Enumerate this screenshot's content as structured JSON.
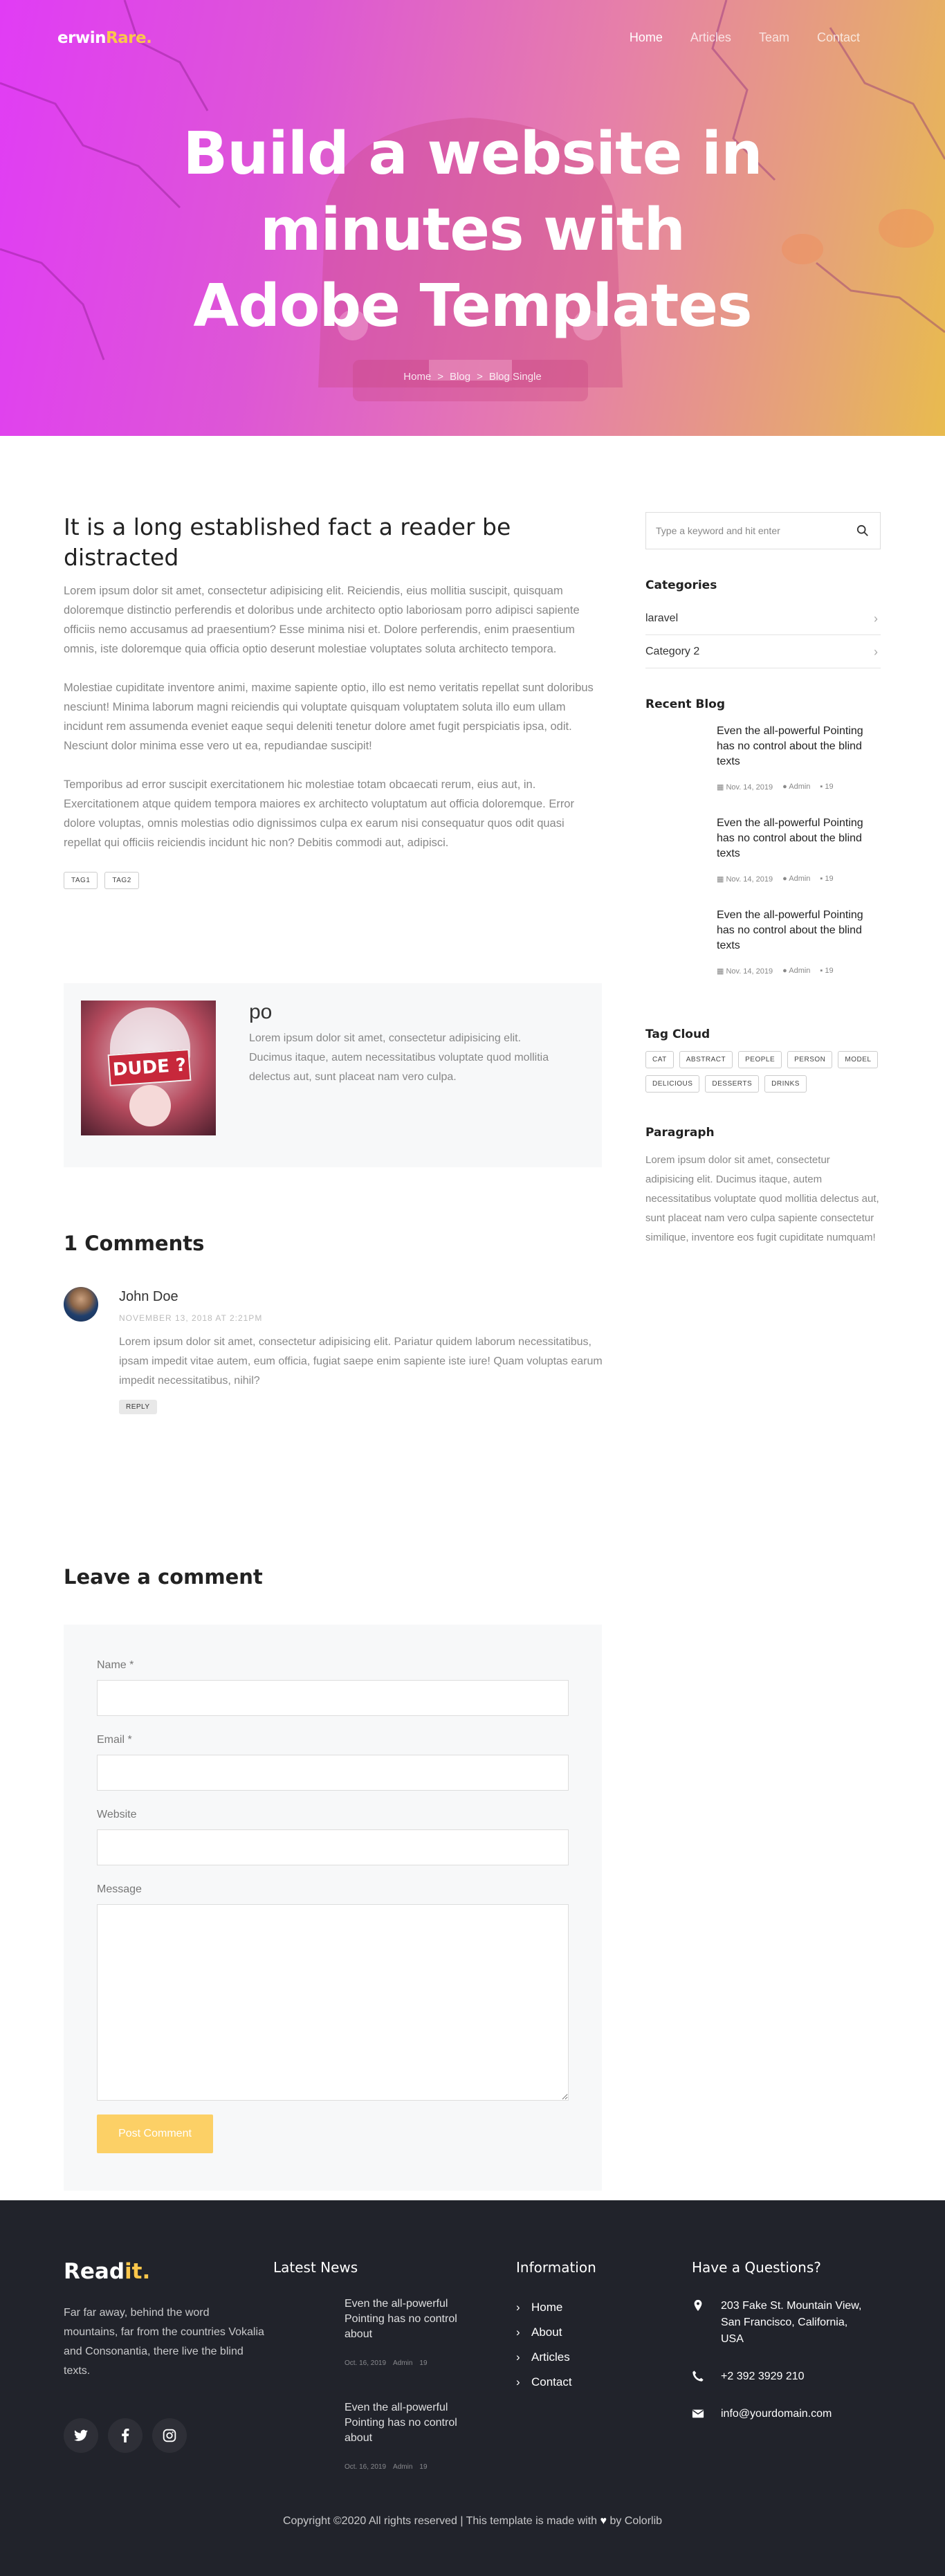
{
  "brand": {
    "name_main": "erwin",
    "name_accent": "Rare",
    "name_dot": "."
  },
  "nav": {
    "items": [
      "Home",
      "Articles",
      "Team",
      "Contact"
    ],
    "active": "Home"
  },
  "hero": {
    "title_line1": "Build a website in",
    "title_line2": "minutes with",
    "title_line3": "Adobe Templates",
    "breadcrumb": [
      "Home",
      "Blog",
      "Blog Single"
    ],
    "breadcrumb_sep": ">"
  },
  "article": {
    "title": "It is a long established fact a reader be distracted",
    "paragraphs": [
      "Lorem ipsum dolor sit amet, consectetur adipisicing elit. Reiciendis, eius mollitia suscipit, quisquam doloremque distinctio perferendis et doloribus unde architecto optio laboriosam porro adipisci sapiente officiis nemo accusamus ad praesentium? Esse minima nisi et. Dolore perferendis, enim praesentium omnis, iste doloremque quia officia optio deserunt molestiae voluptates soluta architecto tempora.",
      "Molestiae cupiditate inventore animi, maxime sapiente optio, illo est nemo veritatis repellat sunt doloribus nesciunt! Minima laborum magni reiciendis qui voluptate quisquam voluptatem soluta illo eum ullam incidunt rem assumenda eveniet eaque sequi deleniti tenetur dolore amet fugit perspiciatis ipsa, odit. Nesciunt dolor minima esse vero ut ea, repudiandae suscipit!",
      "Temporibus ad error suscipit exercitationem hic molestiae totam obcaecati rerum, eius aut, in. Exercitationem atque quidem tempora maiores ex architecto voluptatum aut officia doloremque. Error dolore voluptas, omnis molestias odio dignissimos culpa ex earum nisi consequatur quos odit quasi repellat qui officiis reiciendis incidunt hic non? Debitis commodi aut, adipisci."
    ],
    "tags": [
      "TAG1",
      "TAG2"
    ]
  },
  "author": {
    "name": "po",
    "image_text": "DUDE ?",
    "bio": "Lorem ipsum dolor sit amet, consectetur adipisicing elit. Ducimus itaque, autem necessitatibus voluptate quod mollitia delectus aut, sunt placeat nam vero culpa."
  },
  "comments": {
    "title": "1 Comments",
    "items": [
      {
        "name": "John Doe",
        "date": "NOVEMBER 13, 2018 AT 2:21PM",
        "text": "Lorem ipsum dolor sit amet, consectetur adipisicing elit. Pariatur quidem laborum necessitatibus, ipsam impedit vitae autem, eum officia, fugiat saepe enim sapiente iste iure! Quam voluptas earum impedit necessitatibus, nihil?",
        "reply": "REPLY"
      }
    ]
  },
  "comment_form": {
    "title": "Leave a comment",
    "name_label": "Name *",
    "email_label": "Email *",
    "website_label": "Website",
    "message_label": "Message",
    "submit": "Post Comment"
  },
  "sidebar": {
    "search_placeholder": "Type a keyword and hit enter",
    "categories_title": "Categories",
    "categories": [
      "laravel",
      "Category 2"
    ],
    "recent_title": "Recent Blog",
    "recent": [
      {
        "title": "Even the all-powerful Pointing has no control about the blind texts",
        "date": "Nov. 14, 2019",
        "author": "Admin",
        "comments": "19"
      },
      {
        "title": "Even the all-powerful Pointing has no control about the blind texts",
        "date": "Nov. 14, 2019",
        "author": "Admin",
        "comments": "19"
      },
      {
        "title": "Even the all-powerful Pointing has no control about the blind texts",
        "date": "Nov. 14, 2019",
        "author": "Admin",
        "comments": "19"
      }
    ],
    "tagcloud_title": "Tag Cloud",
    "tagcloud": [
      "CAT",
      "ABSTRACT",
      "PEOPLE",
      "PERSON",
      "MODEL",
      "DELICIOUS",
      "DESSERTS",
      "DRINKS"
    ],
    "paragraph_title": "Paragraph",
    "paragraph_text": "Lorem ipsum dolor sit amet, consectetur adipisicing elit. Ducimus itaque, autem necessitatibus voluptate quod mollitia delectus aut, sunt placeat nam vero culpa sapiente consectetur similique, inventore eos fugit cupiditate numquam!"
  },
  "footer": {
    "logo_main": "Read",
    "logo_accent": "it",
    "logo_dot": ".",
    "about": "Far far away, behind the word mountains, far from the countries Vokalia and Consonantia, there live the blind texts.",
    "news_title": "Latest News",
    "news": [
      {
        "title": "Even the all-powerful Pointing has no control about",
        "date": "Oct. 16, 2019",
        "author": "Admin",
        "comments": "19"
      },
      {
        "title": "Even the all-powerful Pointing has no control about",
        "date": "Oct. 16, 2019",
        "author": "Admin",
        "comments": "19"
      }
    ],
    "info_title": "Information",
    "info": [
      "Home",
      "About",
      "Articles",
      "Contact"
    ],
    "contact_title": "Have a Questions?",
    "address": "203 Fake St. Mountain View, San Francisco, California, USA",
    "phone": "+2 392 3929 210",
    "email": "info@yourdomain.com",
    "copyright_pre": "Copyright ©2020 All rights reserved | This template is made with",
    "copyright_post": "by Colorlib"
  },
  "colors": {
    "accent": "#fac64b",
    "button": "#fcd066",
    "footer_bg": "#21232b",
    "form_bg": "#f7f8f9",
    "hero_start": "#e13cf5",
    "hero_end": "#e8bb4e"
  }
}
